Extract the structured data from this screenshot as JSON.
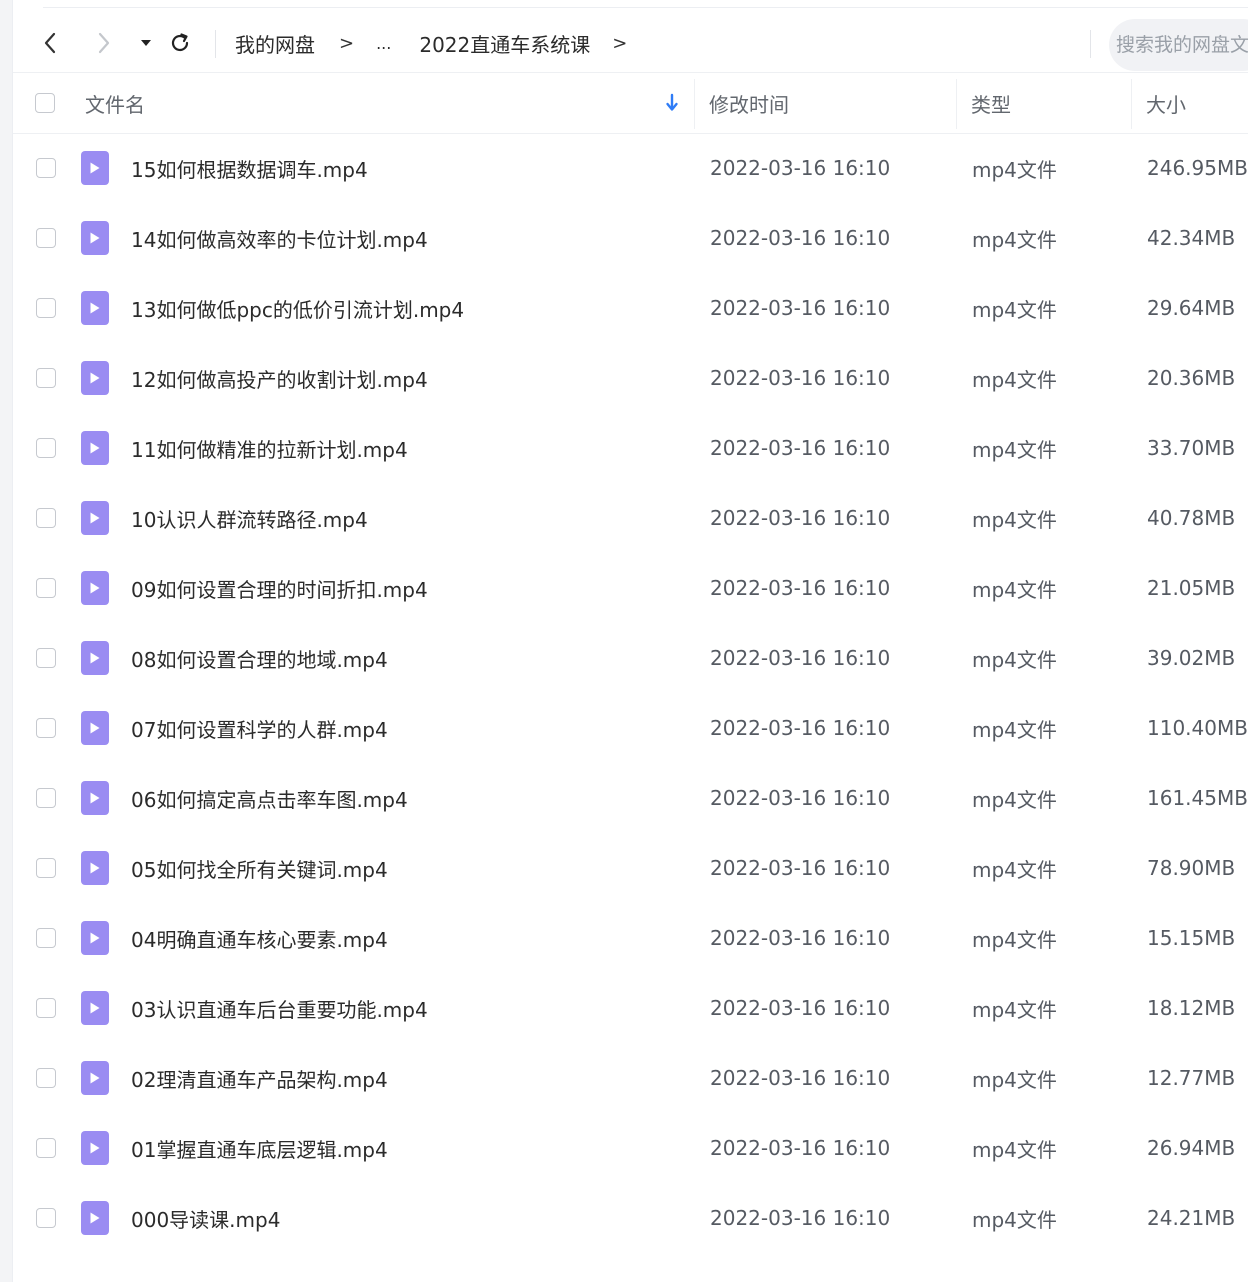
{
  "toolbar": {
    "breadcrumb": [
      "我的网盘",
      "...",
      "2022直通车系统课"
    ],
    "crumb_sep": ">",
    "search_placeholder": "搜索我的网盘文件"
  },
  "header": {
    "name": "文件名",
    "time": "修改时间",
    "type": "类型",
    "size": "大小"
  },
  "colors": {
    "file_icon": "#9a8cf2",
    "sort_arrow": "#2f7cf6"
  },
  "files": [
    {
      "name": "15如何根据数据调车.mp4",
      "time": "2022-03-16 16:10",
      "type": "mp4文件",
      "size": "246.95MB"
    },
    {
      "name": "14如何做高效率的卡位计划.mp4",
      "time": "2022-03-16 16:10",
      "type": "mp4文件",
      "size": "42.34MB"
    },
    {
      "name": "13如何做低ppc的低价引流计划.mp4",
      "time": "2022-03-16 16:10",
      "type": "mp4文件",
      "size": "29.64MB"
    },
    {
      "name": "12如何做高投产的收割计划.mp4",
      "time": "2022-03-16 16:10",
      "type": "mp4文件",
      "size": "20.36MB"
    },
    {
      "name": "11如何做精准的拉新计划.mp4",
      "time": "2022-03-16 16:10",
      "type": "mp4文件",
      "size": "33.70MB"
    },
    {
      "name": "10认识人群流转路径.mp4",
      "time": "2022-03-16 16:10",
      "type": "mp4文件",
      "size": "40.78MB"
    },
    {
      "name": "09如何设置合理的时间折扣.mp4",
      "time": "2022-03-16 16:10",
      "type": "mp4文件",
      "size": "21.05MB"
    },
    {
      "name": "08如何设置合理的地域.mp4",
      "time": "2022-03-16 16:10",
      "type": "mp4文件",
      "size": "39.02MB"
    },
    {
      "name": "07如何设置科学的人群.mp4",
      "time": "2022-03-16 16:10",
      "type": "mp4文件",
      "size": "110.40MB"
    },
    {
      "name": "06如何搞定高点击率车图.mp4",
      "time": "2022-03-16 16:10",
      "type": "mp4文件",
      "size": "161.45MB"
    },
    {
      "name": "05如何找全所有关键词.mp4",
      "time": "2022-03-16 16:10",
      "type": "mp4文件",
      "size": "78.90MB"
    },
    {
      "name": "04明确直通车核心要素.mp4",
      "time": "2022-03-16 16:10",
      "type": "mp4文件",
      "size": "15.15MB"
    },
    {
      "name": "03认识直通车后台重要功能.mp4",
      "time": "2022-03-16 16:10",
      "type": "mp4文件",
      "size": "18.12MB"
    },
    {
      "name": "02理清直通车产品架构.mp4",
      "time": "2022-03-16 16:10",
      "type": "mp4文件",
      "size": "12.77MB"
    },
    {
      "name": "01掌握直通车底层逻辑.mp4",
      "time": "2022-03-16 16:10",
      "type": "mp4文件",
      "size": "26.94MB"
    },
    {
      "name": "000导读课.mp4",
      "time": "2022-03-16 16:10",
      "type": "mp4文件",
      "size": "24.21MB"
    }
  ]
}
